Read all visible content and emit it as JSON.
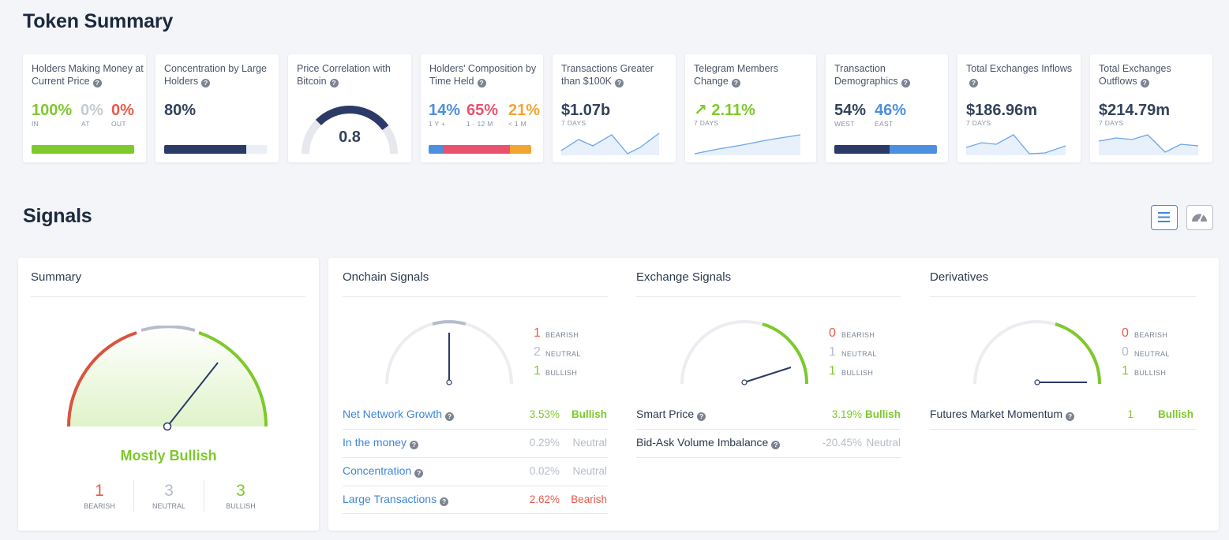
{
  "token_summary": {
    "title": "Token Summary",
    "cards": {
      "holders_money": {
        "title": "Holders Making Money at Current Price",
        "in_val": "100%",
        "at_val": "0%",
        "out_val": "0%",
        "in_lbl": "IN",
        "at_lbl": "AT",
        "out_lbl": "OUT",
        "in_pct": 100
      },
      "concentration": {
        "title": "Concentration by Large Holders",
        "value": "80%",
        "pct": 80
      },
      "price_corr": {
        "title": "Price Correlation with Bitcoin",
        "value": "0.8",
        "level": 0.8
      },
      "composition": {
        "title": "Holders' Composition by Time Held",
        "v1": "14%",
        "v2": "65%",
        "v3": "21%",
        "l1": "1 Y +",
        "l2": "1 - 12 M",
        "l3": "< 1 M",
        "p1": 14,
        "p2": 65,
        "p3": 21
      },
      "tx_greater": {
        "title": "Transactions Greater than $100K",
        "value": "$1.07b",
        "period": "7 DAYS"
      },
      "telegram": {
        "title": "Telegram Members Change",
        "value": "2.11%",
        "period": "7 DAYS",
        "arrow": "arrow-up-right-icon"
      },
      "demographics": {
        "title": "Transaction Demographics",
        "west_val": "54%",
        "east_val": "46%",
        "west_lbl": "WEST",
        "east_lbl": "EAST",
        "west_pct": 54
      },
      "inflows": {
        "title": "Total Exchanges Inflows",
        "value": "$186.96m",
        "period": "7 DAYS"
      },
      "outflows": {
        "title": "Total Exchanges Outflows",
        "value": "$214.79m",
        "period": "7 DAYS"
      }
    }
  },
  "signals": {
    "title": "Signals",
    "view_buttons": {
      "list": "list-icon",
      "gauge": "gauge-icon"
    },
    "summary": {
      "title": "Summary",
      "verdict": "Mostly Bullish",
      "bearish": "1",
      "neutral": "3",
      "bullish": "3",
      "bearish_lbl": "BEARISH",
      "neutral_lbl": "NEUTRAL",
      "bullish_lbl": "BULLISH"
    },
    "onchain": {
      "title": "Onchain Signals",
      "bearish": "1",
      "neutral": "2",
      "bullish": "1",
      "bearish_lbl": "BEARISH",
      "neutral_lbl": "NEUTRAL",
      "bullish_lbl": "BULLISH",
      "rows": [
        {
          "name": "Net Network Growth",
          "value": "3.53%",
          "signal": "Bullish"
        },
        {
          "name": "In the money",
          "value": "0.29%",
          "signal": "Neutral"
        },
        {
          "name": "Concentration",
          "value": "0.02%",
          "signal": "Neutral"
        },
        {
          "name": "Large Transactions",
          "value": "2.62%",
          "signal": "Bearish"
        }
      ]
    },
    "exchange": {
      "title": "Exchange Signals",
      "bearish": "0",
      "neutral": "1",
      "bullish": "1",
      "bearish_lbl": "BEARISH",
      "neutral_lbl": "NEUTRAL",
      "bullish_lbl": "BULLISH",
      "rows": [
        {
          "name": "Smart Price",
          "value": "3.19%",
          "signal": "Bullish"
        },
        {
          "name": "Bid-Ask Volume Imbalance",
          "value": "-20.45%",
          "signal": "Neutral"
        }
      ]
    },
    "derivatives": {
      "title": "Derivatives",
      "bearish": "0",
      "neutral": "0",
      "bullish": "1",
      "bearish_lbl": "BEARISH",
      "neutral_lbl": "NEUTRAL",
      "bullish_lbl": "BULLISH",
      "rows": [
        {
          "name": "Futures Market Momentum",
          "value": "1",
          "signal": "Bullish"
        }
      ]
    }
  },
  "colors": {
    "bullish": "#7ec92b",
    "bearish": "#e75a4a",
    "neutral": "#b6bccc",
    "link": "#3f86d8",
    "navy": "#2b3a67"
  }
}
